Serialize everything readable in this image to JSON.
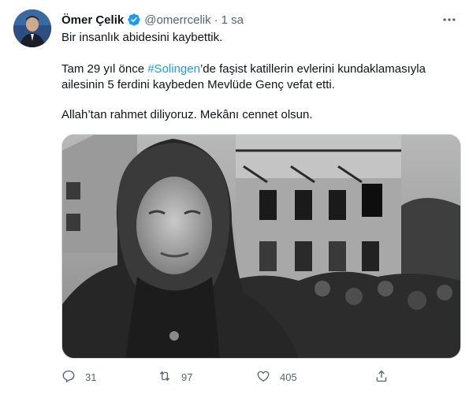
{
  "tweet": {
    "author_name": "Ömer Çelik",
    "handle": "@omerrcelik",
    "separator": "·",
    "time": "1 sa",
    "text": {
      "line1": "Bir insanlık abidesini kaybettik.",
      "p2_before": "Tam 29 yıl önce ",
      "hashtag": "#Solingen",
      "p2_after": "’de faşist katillerin evlerini kundaklamasıyla ailesinin 5 ferdini kaybeden  Mevlüde Genç vefat etti.",
      "line3": "Allah’tan rahmet diliyoruz. Mekânı cennet olsun."
    },
    "actions": {
      "reply_count": "31",
      "retweet_count": "97",
      "like_count": "405"
    }
  },
  "colors": {
    "accent": "#1d9bf0",
    "secondary_text": "#536471",
    "primary_text": "#0f1419"
  },
  "icons": [
    "verified-badge-icon",
    "more-icon",
    "reply-icon",
    "retweet-icon",
    "like-icon",
    "share-icon"
  ]
}
